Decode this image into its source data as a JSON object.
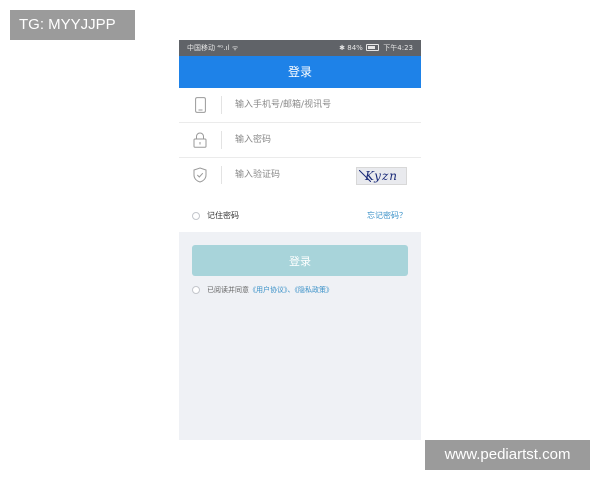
{
  "watermarks": {
    "top_left": "TG: MYYJJPP",
    "bottom_right": "www.pediartst.com"
  },
  "status_bar": {
    "carrier": "中国移动",
    "signal": "⁴ᴳ.ıl",
    "wifi": "ᯤ",
    "bluetooth": "✱",
    "battery": "84%",
    "time": "下午4:23"
  },
  "header": {
    "title": "登录"
  },
  "form": {
    "account": {
      "placeholder": "输入手机号/邮箱/视讯号",
      "icon": "phone-icon"
    },
    "password": {
      "placeholder": "输入密码",
      "icon": "lock-icon"
    },
    "captcha": {
      "placeholder": "输入验证码",
      "icon": "shield-icon",
      "image_text": "Kyzn"
    }
  },
  "remember_label": "记住密码",
  "forgot_link": "忘记密码？",
  "login_button": "登录",
  "agreement": {
    "prefix": "已阅读并同意",
    "user_agreement": "《用户协议》",
    "separator": "、",
    "privacy_policy": "《隐私政策》"
  },
  "colors": {
    "header": "#1e82e8",
    "button": "#a8d4da",
    "link": "#3a91c8",
    "background": "#eff1f5"
  }
}
